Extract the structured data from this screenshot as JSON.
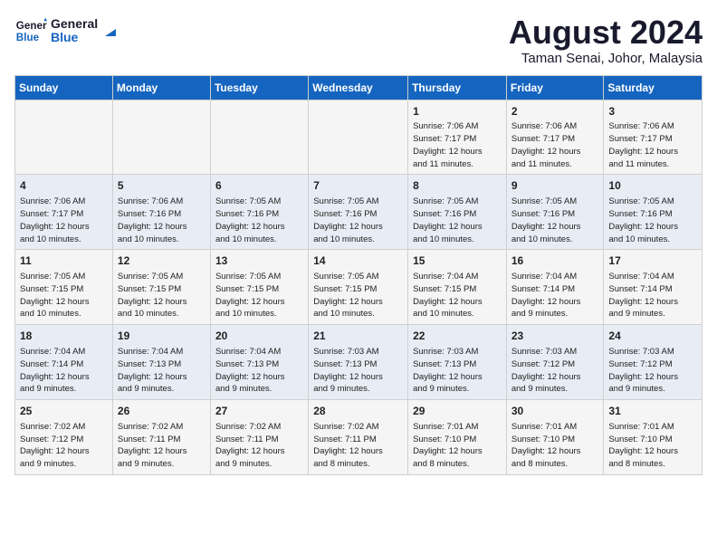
{
  "header": {
    "logo_line1": "General",
    "logo_line2": "Blue",
    "month_year": "August 2024",
    "location": "Taman Senai, Johor, Malaysia"
  },
  "weekdays": [
    "Sunday",
    "Monday",
    "Tuesday",
    "Wednesday",
    "Thursday",
    "Friday",
    "Saturday"
  ],
  "weeks": [
    [
      {
        "day": "",
        "info": ""
      },
      {
        "day": "",
        "info": ""
      },
      {
        "day": "",
        "info": ""
      },
      {
        "day": "",
        "info": ""
      },
      {
        "day": "1",
        "info": "Sunrise: 7:06 AM\nSunset: 7:17 PM\nDaylight: 12 hours\nand 11 minutes."
      },
      {
        "day": "2",
        "info": "Sunrise: 7:06 AM\nSunset: 7:17 PM\nDaylight: 12 hours\nand 11 minutes."
      },
      {
        "day": "3",
        "info": "Sunrise: 7:06 AM\nSunset: 7:17 PM\nDaylight: 12 hours\nand 11 minutes."
      }
    ],
    [
      {
        "day": "4",
        "info": "Sunrise: 7:06 AM\nSunset: 7:17 PM\nDaylight: 12 hours\nand 10 minutes."
      },
      {
        "day": "5",
        "info": "Sunrise: 7:06 AM\nSunset: 7:16 PM\nDaylight: 12 hours\nand 10 minutes."
      },
      {
        "day": "6",
        "info": "Sunrise: 7:05 AM\nSunset: 7:16 PM\nDaylight: 12 hours\nand 10 minutes."
      },
      {
        "day": "7",
        "info": "Sunrise: 7:05 AM\nSunset: 7:16 PM\nDaylight: 12 hours\nand 10 minutes."
      },
      {
        "day": "8",
        "info": "Sunrise: 7:05 AM\nSunset: 7:16 PM\nDaylight: 12 hours\nand 10 minutes."
      },
      {
        "day": "9",
        "info": "Sunrise: 7:05 AM\nSunset: 7:16 PM\nDaylight: 12 hours\nand 10 minutes."
      },
      {
        "day": "10",
        "info": "Sunrise: 7:05 AM\nSunset: 7:16 PM\nDaylight: 12 hours\nand 10 minutes."
      }
    ],
    [
      {
        "day": "11",
        "info": "Sunrise: 7:05 AM\nSunset: 7:15 PM\nDaylight: 12 hours\nand 10 minutes."
      },
      {
        "day": "12",
        "info": "Sunrise: 7:05 AM\nSunset: 7:15 PM\nDaylight: 12 hours\nand 10 minutes."
      },
      {
        "day": "13",
        "info": "Sunrise: 7:05 AM\nSunset: 7:15 PM\nDaylight: 12 hours\nand 10 minutes."
      },
      {
        "day": "14",
        "info": "Sunrise: 7:05 AM\nSunset: 7:15 PM\nDaylight: 12 hours\nand 10 minutes."
      },
      {
        "day": "15",
        "info": "Sunrise: 7:04 AM\nSunset: 7:15 PM\nDaylight: 12 hours\nand 10 minutes."
      },
      {
        "day": "16",
        "info": "Sunrise: 7:04 AM\nSunset: 7:14 PM\nDaylight: 12 hours\nand 9 minutes."
      },
      {
        "day": "17",
        "info": "Sunrise: 7:04 AM\nSunset: 7:14 PM\nDaylight: 12 hours\nand 9 minutes."
      }
    ],
    [
      {
        "day": "18",
        "info": "Sunrise: 7:04 AM\nSunset: 7:14 PM\nDaylight: 12 hours\nand 9 minutes."
      },
      {
        "day": "19",
        "info": "Sunrise: 7:04 AM\nSunset: 7:13 PM\nDaylight: 12 hours\nand 9 minutes."
      },
      {
        "day": "20",
        "info": "Sunrise: 7:04 AM\nSunset: 7:13 PM\nDaylight: 12 hours\nand 9 minutes."
      },
      {
        "day": "21",
        "info": "Sunrise: 7:03 AM\nSunset: 7:13 PM\nDaylight: 12 hours\nand 9 minutes."
      },
      {
        "day": "22",
        "info": "Sunrise: 7:03 AM\nSunset: 7:13 PM\nDaylight: 12 hours\nand 9 minutes."
      },
      {
        "day": "23",
        "info": "Sunrise: 7:03 AM\nSunset: 7:12 PM\nDaylight: 12 hours\nand 9 minutes."
      },
      {
        "day": "24",
        "info": "Sunrise: 7:03 AM\nSunset: 7:12 PM\nDaylight: 12 hours\nand 9 minutes."
      }
    ],
    [
      {
        "day": "25",
        "info": "Sunrise: 7:02 AM\nSunset: 7:12 PM\nDaylight: 12 hours\nand 9 minutes."
      },
      {
        "day": "26",
        "info": "Sunrise: 7:02 AM\nSunset: 7:11 PM\nDaylight: 12 hours\nand 9 minutes."
      },
      {
        "day": "27",
        "info": "Sunrise: 7:02 AM\nSunset: 7:11 PM\nDaylight: 12 hours\nand 9 minutes."
      },
      {
        "day": "28",
        "info": "Sunrise: 7:02 AM\nSunset: 7:11 PM\nDaylight: 12 hours\nand 8 minutes."
      },
      {
        "day": "29",
        "info": "Sunrise: 7:01 AM\nSunset: 7:10 PM\nDaylight: 12 hours\nand 8 minutes."
      },
      {
        "day": "30",
        "info": "Sunrise: 7:01 AM\nSunset: 7:10 PM\nDaylight: 12 hours\nand 8 minutes."
      },
      {
        "day": "31",
        "info": "Sunrise: 7:01 AM\nSunset: 7:10 PM\nDaylight: 12 hours\nand 8 minutes."
      }
    ]
  ]
}
